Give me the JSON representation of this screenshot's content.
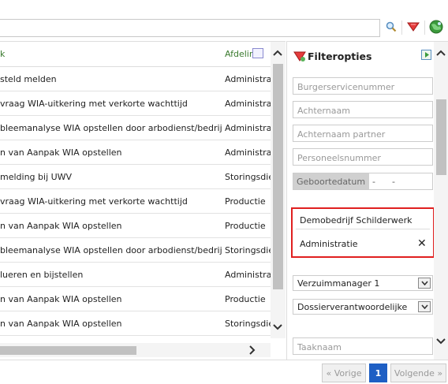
{
  "toolbar": {
    "search_value": "",
    "icons": [
      "search-icon",
      "filter-icon",
      "globe-icon"
    ]
  },
  "list": {
    "headers": {
      "task": "k",
      "department": "Afdeling"
    },
    "rows": [
      {
        "task": "steld melden",
        "department": "Administratie"
      },
      {
        "task": "vraag WIA-uitkering met verkorte wachttijd",
        "department": "Administratie"
      },
      {
        "task": "bleemanalyse WIA opstellen door arbodienst/bedrijfsarts",
        "department": "Administratie"
      },
      {
        "task": "n van Aanpak WIA opstellen",
        "department": "Administratie"
      },
      {
        "task": "melding bij UWV",
        "department": "Storingsdienst"
      },
      {
        "task": "vraag WIA-uitkering met verkorte wachttijd",
        "department": "Productie"
      },
      {
        "task": "n van Aanpak WIA opstellen",
        "department": "Productie"
      },
      {
        "task": "bleemanalyse WIA opstellen door arbodienst/bedrijfsarts",
        "department": "Storingsdienst"
      },
      {
        "task": "lueren en bijstellen",
        "department": "Administratie"
      },
      {
        "task": "n van Aanpak WIA opstellen",
        "department": "Productie"
      },
      {
        "task": "n van Aanpak WIA opstellen",
        "department": "Storingsdienst"
      }
    ]
  },
  "filters": {
    "title": "Filteropties",
    "bsn_placeholder": "Burgerservicenummer",
    "lastname_placeholder": "Achternaam",
    "partner_placeholder": "Achternaam partner",
    "staffnr_placeholder": "Personeelsnummer",
    "birthdate_label": "Geboortedatum",
    "birthdate_value": "-      -",
    "company": "Demobedrijf Schilderwerk",
    "department": "Administratie",
    "clear_symbol": "✕",
    "absence_manager": "Verzuimmanager 1",
    "case_owner": "Dossierverantwoordelijke",
    "task_placeholder": "Taaknaam"
  },
  "pagination": {
    "prev": "« Vorige",
    "current": "1",
    "next": "Volgende »"
  },
  "colors": {
    "accent_green": "#3a7a2e",
    "highlight_red": "#e02020",
    "page_blue": "#1e5fc4"
  }
}
